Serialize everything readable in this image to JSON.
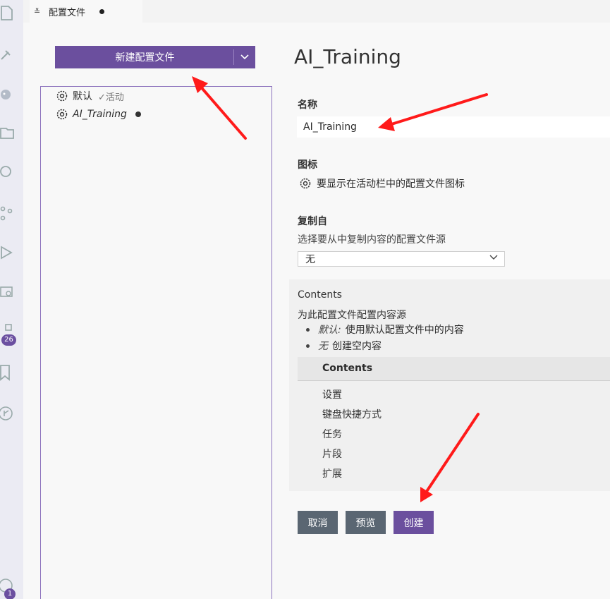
{
  "tab": {
    "label": "配置文件"
  },
  "left": {
    "new_button_label": "新建配置文件",
    "profiles": [
      {
        "name": "默认",
        "status": "✓活动",
        "italic": false
      },
      {
        "name": "AI_Training",
        "status": "",
        "italic": true
      }
    ]
  },
  "editor": {
    "title": "AI_Training",
    "name_label": "名称",
    "name_value": "AI_Training",
    "icon_label": "图标",
    "icon_text": "要显示在活动栏中的配置文件图标",
    "copy_label": "复制自",
    "copy_desc": "选择要从中复制内容的配置文件源",
    "copy_value": "无",
    "contents_title": "Contents",
    "contents_desc": "为此配置文件配置内容源",
    "bullets": [
      {
        "term": "默认:",
        "text": "使用默认配置文件中的内容"
      },
      {
        "term": "无",
        "text": "创建空内容"
      }
    ],
    "table_header": "Contents",
    "rows": [
      "设置",
      "键盘快捷方式",
      "任务",
      "片段",
      "扩展"
    ]
  },
  "buttons": {
    "cancel": "取消",
    "preview": "预览",
    "create": "创建"
  },
  "badges": {
    "extensions": "26",
    "accounts": "1"
  },
  "colors": {
    "accent": "#6b4f9e",
    "arrow": "#ff1a1a"
  }
}
